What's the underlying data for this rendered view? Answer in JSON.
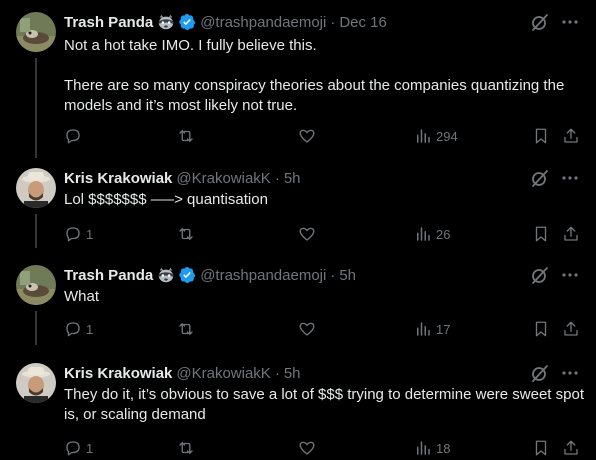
{
  "tweets": [
    {
      "name": "Trash Panda",
      "emoji": "raccoon-icon",
      "verified": true,
      "handle": "@trashpandaemoji",
      "time": "Dec 16",
      "paragraphs": [
        "Not a hot take IMO. I fully believe this.",
        "There are so many conspiracy theories about the companies quantizing the models and it’s most likely not true."
      ],
      "replies": "",
      "views": "294"
    },
    {
      "name": "Kris Krakowiak",
      "emoji": "",
      "verified": false,
      "handle": "@KrakowiakK",
      "time": "5h",
      "paragraphs": [
        "Lol $$$$$$$ —–> quantisation"
      ],
      "replies": "1",
      "views": "26"
    },
    {
      "name": "Trash Panda",
      "emoji": "raccoon-icon",
      "verified": true,
      "handle": "@trashpandaemoji",
      "time": "5h",
      "paragraphs": [
        "What"
      ],
      "replies": "1",
      "views": "17"
    },
    {
      "name": "Kris Krakowiak",
      "emoji": "",
      "verified": false,
      "handle": "@KrakowiakK",
      "time": "5h",
      "paragraphs": [
        "They do it, it’s obvious to save a lot of $$$ trying to determine were sweet spot is, or scaling demand"
      ],
      "replies": "1",
      "views": "18"
    }
  ],
  "dot": "·",
  "colors": {
    "verified": "#1d9bf0",
    "muted": "#71767b",
    "text": "#e7e9ea",
    "background": "#000000"
  }
}
